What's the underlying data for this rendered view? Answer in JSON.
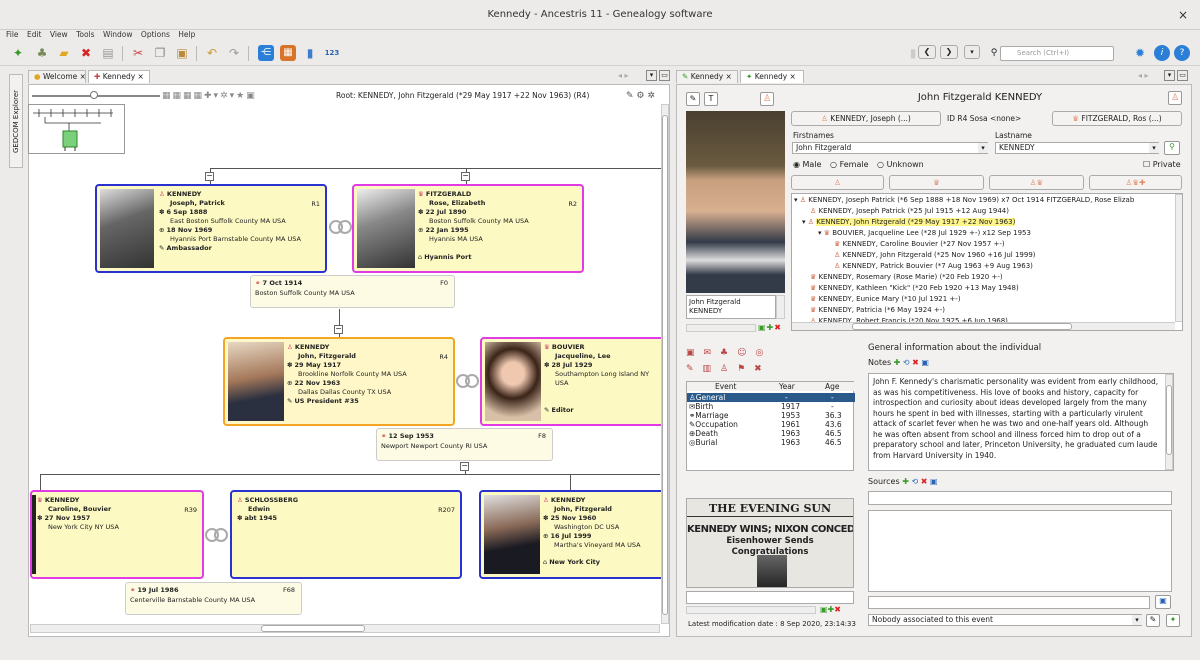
{
  "window": {
    "title": "Kennedy - Ancestris 11 - Genealogy software",
    "close": "×"
  },
  "menu": [
    "File",
    "Edit",
    "View",
    "Tools",
    "Window",
    "Options",
    "Help"
  ],
  "toolbar": {
    "search_placeholder": "Search (Ctrl+I)",
    "tools_label": "123"
  },
  "left": {
    "tabs": [
      "Welcome ×",
      "Kennedy ×"
    ],
    "side_tab": "GEDCOM Explorer",
    "root_label": "Root: KENNEDY, John Fitzgerald (*29 May 1917 +22 Nov 1963) (R4)"
  },
  "cards": {
    "joseph": {
      "last": "KENNEDY",
      "first": "Joseph, Patrick",
      "ref": "R1",
      "birth": "6 Sep 1888",
      "bplace": "East Boston Suffolk County MA USA",
      "death": "18 Nov 1969",
      "dplace": "Hyannis Port Barnstable County MA USA",
      "occ": "Ambassador"
    },
    "rose": {
      "last": "FITZGERALD",
      "first": "Rose, Elizabeth",
      "ref": "R2",
      "birth": "22 Jul 1890",
      "bplace": "Boston Suffolk County MA USA",
      "death": "22 Jan 1995",
      "dplace": "Hyannis MA USA",
      "res": "Hyannis Port"
    },
    "fam1": {
      "date": "7 Oct 1914",
      "place": "Boston Suffolk County MA USA",
      "ref": "F0"
    },
    "jfk": {
      "last": "KENNEDY",
      "first": "John, Fitzgerald",
      "ref": "R4",
      "birth": "29 May 1917",
      "bplace": "Brookline Norfolk County MA USA",
      "death": "22 Nov 1963",
      "dplace": "Dallas Dallas County TX USA",
      "occ": "US President #35"
    },
    "jackie": {
      "last": "BOUVIER",
      "first": "Jacqueline, Lee",
      "birth": "28 Jul 1929",
      "bplace": "Southampton Long Island NY USA",
      "occ": "Editor"
    },
    "fam2": {
      "date": "12 Sep 1953",
      "place": "Newport Newport County RI USA",
      "ref": "F8"
    },
    "caroline": {
      "last": "KENNEDY",
      "first": "Caroline, Bouvier",
      "ref": "R39",
      "birth": "27 Nov 1957",
      "bplace": "New York City NY USA"
    },
    "edwin": {
      "last": "SCHLOSSBERG",
      "first": "Edwin",
      "ref": "R207",
      "birth": "abt 1945"
    },
    "jfkjr": {
      "last": "KENNEDY",
      "first": "John, Fitzgerald",
      "birth": "25 Nov 1960",
      "bplace": "Washington DC USA",
      "death": "16 Jul 1999",
      "dplace": "Martha's Vineyard MA USA",
      "res": "New York City"
    },
    "fam3": {
      "date": "19 Jul 1986",
      "place": "Centerville Barnstable County MA USA",
      "ref": "F68"
    }
  },
  "right": {
    "tabs": [
      "Kennedy ×",
      "Kennedy ×"
    ],
    "name_title": "John Fitzgerald KENNEDY",
    "father_btn": "KENNEDY, Joseph (...)",
    "id_label": "ID R4  Sosa <none>",
    "mother_btn": "FITZGERALD, Ros (...)",
    "firstnames_label": "Firstnames",
    "lastname_label": "Lastname",
    "firstnames": "John Fitzgerald",
    "lastname": "KENNEDY",
    "sex": [
      "Male",
      "Female",
      "Unknown"
    ],
    "private": "Private",
    "photo_caption": "John Fitzgerald\nKENNEDY",
    "tree": [
      "KENNEDY, Joseph Patrick (*6 Sep 1888 +18 Nov 1969) x7 Oct 1914 FITZGERALD, Rose Elizab",
      "KENNEDY, Joseph Patrick (*25 Jul 1915 +12 Aug 1944)",
      "KENNEDY, John Fitzgerald (*29 May 1917 +22 Nov 1963)",
      "BOUVIER, Jacqueline Lee (*28 Jul 1929 +-) x12 Sep 1953",
      "KENNEDY, Caroline Bouvier (*27 Nov 1957 +-)",
      "KENNEDY, John Fitzgerald (*25 Nov 1960 +16 Jul 1999)",
      "KENNEDY, Patrick Bouvier (*7 Aug 1963 +9 Aug 1963)",
      "KENNEDY, Rosemary (Rose Marie) (*20 Feb 1920 +-)",
      "KENNEDY, Kathleen \"Kick\" (*20 Feb 1920 +13 May 1948)",
      "KENNEDY, Eunice Mary (*10 Jul 1921 +-)",
      "KENNEDY, Patricia (*6 May 1924 +-)",
      "KENNEDY, Robert Francis (*20 Nov 1925 +6 Jun 1968)"
    ],
    "events_header": [
      "Event",
      "Year",
      "Age"
    ],
    "events": [
      {
        "e": "General",
        "y": "-",
        "a": "-"
      },
      {
        "e": "Birth",
        "y": "1917",
        "a": "-"
      },
      {
        "e": "Marriage",
        "y": "1953",
        "a": "36.3"
      },
      {
        "e": "Occupation",
        "y": "1961",
        "a": "43.6"
      },
      {
        "e": "Death",
        "y": "1963",
        "a": "46.5"
      },
      {
        "e": "Burial",
        "y": "1963",
        "a": "46.5"
      }
    ],
    "general_title": "General information about the individual",
    "notes_label": "Notes",
    "sources_label": "Sources",
    "notes": "John F. Kennedy's charismatic personality was evident from early childhood, as was his competitiveness.  His love of books and history, capacity for introspection and curiosity about ideas developed largely from the many hours he spent in bed with illnesses, starting with a particularly virulent attack of scarlet fever when he was two and one-half years old.  Although he was often absent from school and illness forced him to drop out of a preparatory school and later, Princeton University, he graduated cum laude from Harvard University in 1940.",
    "newspaper": {
      "masthead": "THE EVENING SUN",
      "headline": "KENNEDY WINS; NIXON CONCEDES",
      "sub": "Eisenhower Sends Congratulations"
    },
    "modified": "Latest modification date : 8 Sep 2020, 23:14:33",
    "assoc": "Nobody associated to this event"
  }
}
